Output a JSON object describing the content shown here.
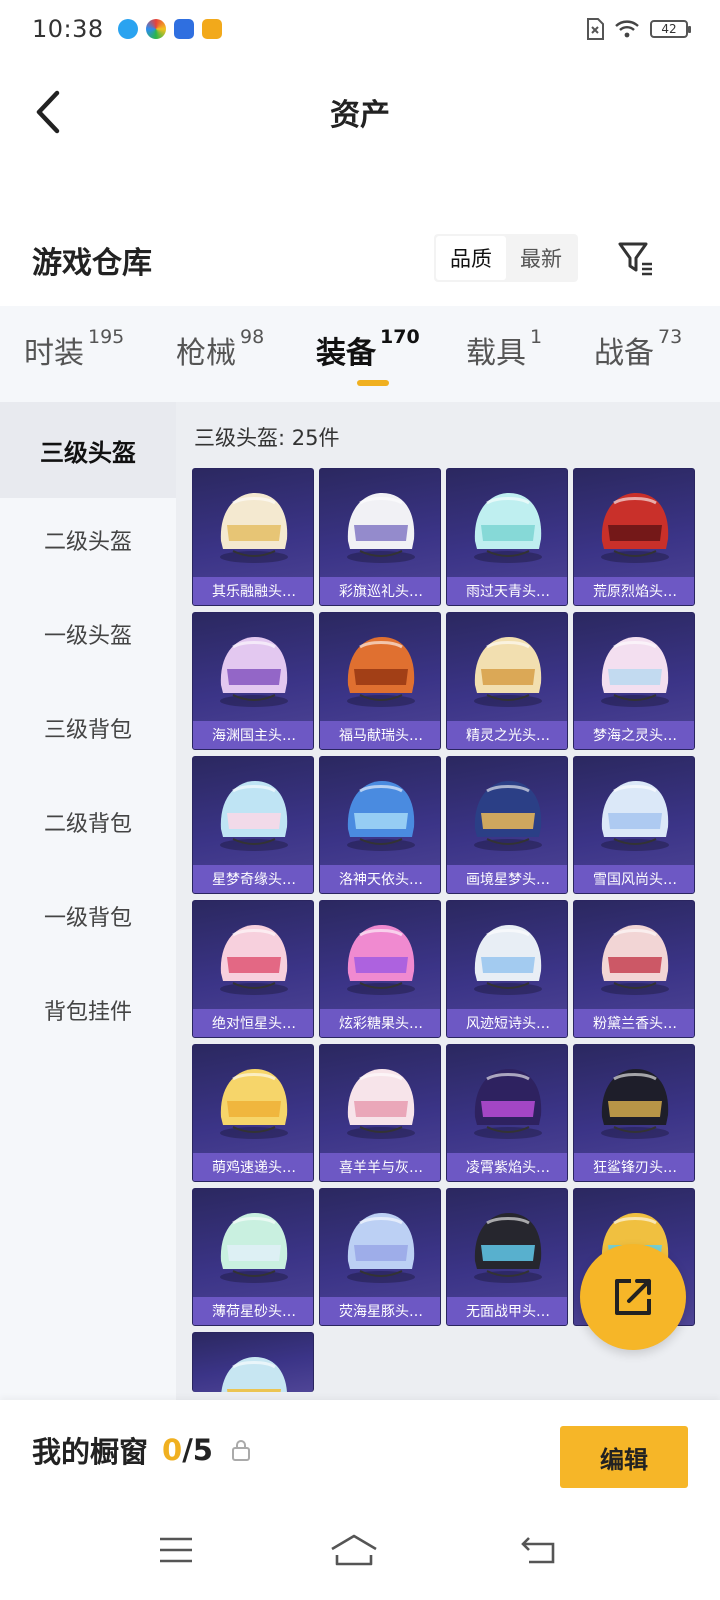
{
  "status_bar": {
    "time": "10:38",
    "battery": "42"
  },
  "header": {
    "title": "资产"
  },
  "section": {
    "title": "游戏仓库",
    "sort_options": [
      "品质",
      "最新"
    ]
  },
  "category_tabs": [
    {
      "label": "时装",
      "count": "195"
    },
    {
      "label": "枪械",
      "count": "98"
    },
    {
      "label": "装备",
      "count": "170"
    },
    {
      "label": "载具",
      "count": "1"
    },
    {
      "label": "战备",
      "count": "73"
    }
  ],
  "sub_nav": [
    "三级头盔",
    "二级头盔",
    "一级头盔",
    "三级背包",
    "二级背包",
    "一级背包",
    "背包挂件"
  ],
  "grid": {
    "caption": "三级头盔: 25件",
    "items": [
      "其乐融融头…",
      "彩旗巡礼头…",
      "雨过天青头…",
      "荒原烈焰头…",
      "海渊国主头…",
      "福马献瑞头…",
      "精灵之光头…",
      "梦海之灵头…",
      "星梦奇缘头…",
      "洛神天依头…",
      "画境星梦头…",
      "雪国风尚头…",
      "绝对恒星头…",
      "炫彩糖果头…",
      "风迹短诗头…",
      "粉黛兰香头…",
      "萌鸡速递头…",
      "喜羊羊与灰…",
      "凌霄紫焰头…",
      "狂鲨锋刃头…",
      "薄荷星砂头…",
      "荧海星豚头…",
      "无面战甲头…",
      "",
      ""
    ]
  },
  "showcase": {
    "label": "我的橱窗",
    "current": "0",
    "separator": "/",
    "max": "5",
    "edit_label": "编辑"
  },
  "colors": {
    "accent": "#f6b628",
    "card_bg": "#3b3487",
    "card_label_bg": "#6d58c4"
  }
}
